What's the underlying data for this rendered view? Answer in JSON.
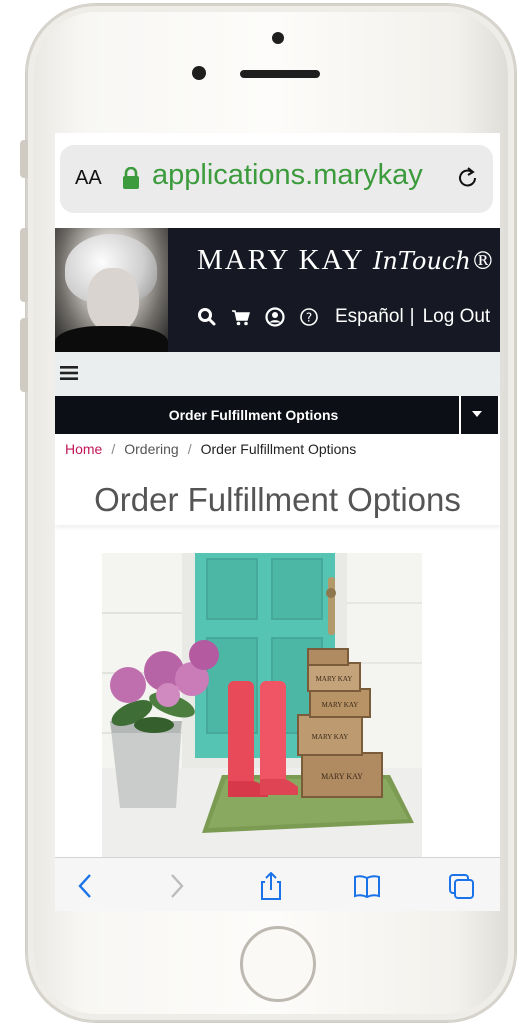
{
  "browser": {
    "text_size_label": "AA",
    "url": "applications.marykay"
  },
  "header": {
    "brand": "MARY KAY",
    "brand_script": "InTouch®",
    "language_link": "Español",
    "divider": "|",
    "logout_link": "Log Out",
    "icons": [
      "search-icon",
      "cart-icon",
      "user-icon",
      "help-icon"
    ]
  },
  "nav": {
    "dropdown_label": "Order Fulfillment Options"
  },
  "breadcrumb": {
    "home": "Home",
    "separator": "/",
    "ordering": "Ordering",
    "current": "Order Fulfillment Options"
  },
  "main": {
    "title": "Order Fulfillment Options",
    "hero_box_text": "MARY KAY"
  },
  "colors": {
    "url_green": "#3c9b3c",
    "header_bg": "#161823",
    "breadcrumb_home": "#c0185a",
    "door": "#56c4b3",
    "boots": "#e84a5a"
  }
}
